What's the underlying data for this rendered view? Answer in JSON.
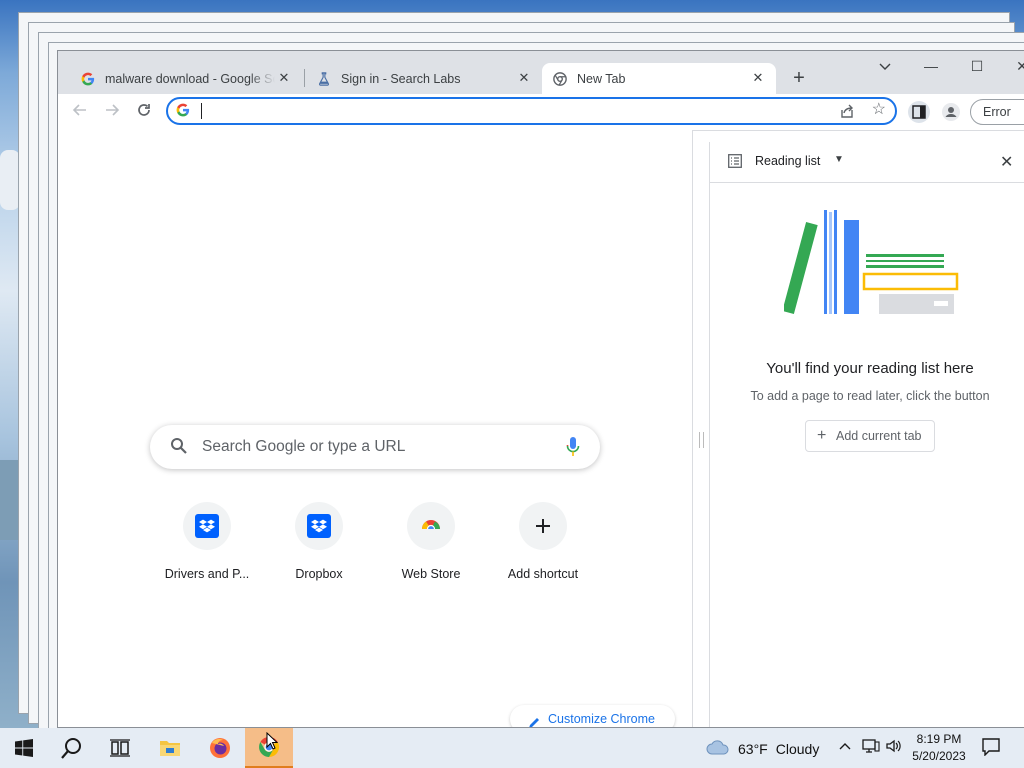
{
  "tabs": [
    {
      "title": "malware download - Google Search",
      "icon": "google-g-icon"
    },
    {
      "title": "Sign in - Search Labs",
      "icon": "labs-flask-icon"
    },
    {
      "title": "New Tab",
      "icon": "chrome-icon",
      "active": true
    }
  ],
  "omnibox": {
    "value": ""
  },
  "toolbar": {
    "error_label": "Error"
  },
  "ntp": {
    "search_placeholder": "Search Google or type a URL",
    "shortcuts": [
      {
        "label": "Drivers and P...",
        "icon": "dropbox-icon"
      },
      {
        "label": "Dropbox",
        "icon": "dropbox-icon"
      },
      {
        "label": "Web Store",
        "icon": "chrome-web-store-icon"
      },
      {
        "label": "Add shortcut",
        "icon": "plus-icon"
      }
    ],
    "customize_label": "Customize Chrome"
  },
  "side_panel": {
    "title": "Reading list",
    "empty_title": "You'll find your reading list here",
    "empty_desc": "To add a page to read later, click the button",
    "add_button": "Add current tab"
  },
  "taskbar": {
    "weather_temp": "63°F",
    "weather_cond": "Cloudy",
    "time": "8:19 PM",
    "date": "5/20/2023"
  },
  "colors": {
    "accent": "#1a73e8",
    "taskbar_active": "#f5bd88"
  }
}
